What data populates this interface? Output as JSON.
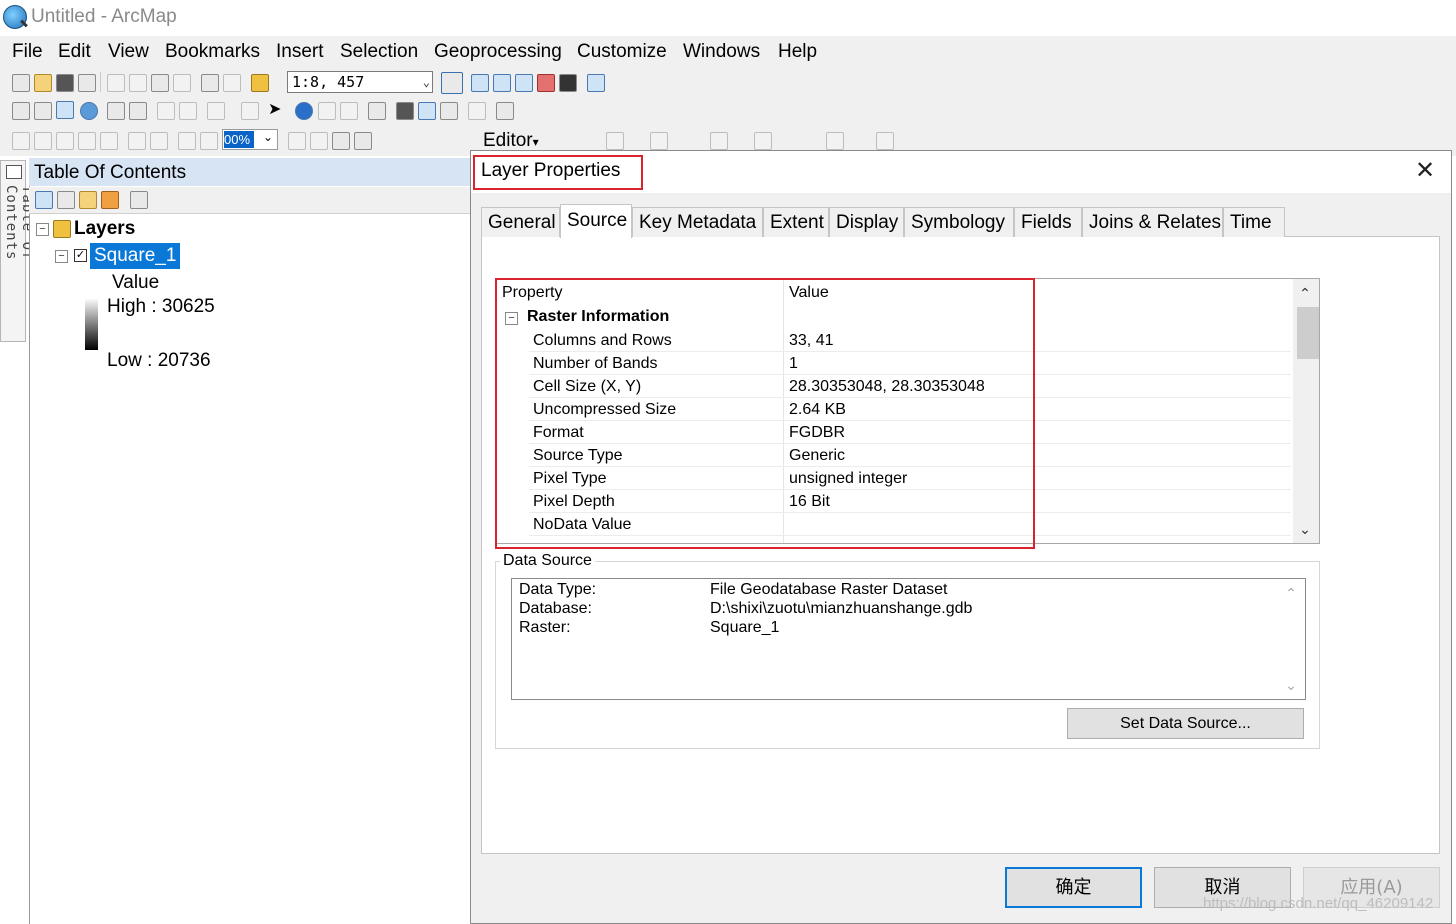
{
  "window": {
    "title": "Untitled - ArcMap"
  },
  "menu": [
    "File",
    "Edit",
    "View",
    "Bookmarks",
    "Insert",
    "Selection",
    "Geoprocessing",
    "Customize",
    "Windows",
    "Help"
  ],
  "toolbar": {
    "scale": "1:8, 457",
    "zoom_value": "00%",
    "editor_label": "Editor"
  },
  "toc": {
    "tab_label": "Table Of Contents",
    "title": "Table Of Contents",
    "root_label": "Layers",
    "layer": {
      "name": "Square_1",
      "checked": true,
      "legend_title": "Value",
      "high": "High : 30625",
      "low": "Low : 20736"
    }
  },
  "dialog": {
    "title": "Layer Properties",
    "tabs": [
      "General",
      "Source",
      "Key Metadata",
      "Extent",
      "Display",
      "Symbology",
      "Fields",
      "Joins & Relates",
      "Time"
    ],
    "active_tab": "Source",
    "property_table": {
      "header_property": "Property",
      "header_value": "Value",
      "group": "Raster Information",
      "rows": [
        {
          "key": "Columns and Rows",
          "value": "33, 41"
        },
        {
          "key": "Number of Bands",
          "value": "1"
        },
        {
          "key": "Cell Size (X, Y)",
          "value": "28.30353048, 28.30353048"
        },
        {
          "key": "Uncompressed Size",
          "value": "2.64 KB"
        },
        {
          "key": "Format",
          "value": "FGDBR"
        },
        {
          "key": "Source Type",
          "value": "Generic"
        },
        {
          "key": "Pixel Type",
          "value": "unsigned integer"
        },
        {
          "key": "Pixel Depth",
          "value": "16 Bit"
        },
        {
          "key": "NoData Value",
          "value": ""
        }
      ]
    },
    "data_source": {
      "label": "Data Source",
      "items": [
        {
          "label": "Data Type:",
          "value": "File Geodatabase Raster Dataset"
        },
        {
          "label": "Database:",
          "value": "D:\\shixi\\zuotu\\mianzhuanshange.gdb"
        },
        {
          "label": "Raster:",
          "value": "Square_1"
        }
      ],
      "set_button": "Set Data Source..."
    },
    "buttons": {
      "ok": "确定",
      "cancel": "取消",
      "apply": "应用(A)"
    }
  },
  "watermark": "https://blog.csdn.net/qq_46209142",
  "colors": {
    "highlight_red": "#d9232e",
    "selection_blue": "#0a78d7",
    "toc_header": "#d6e4f4"
  }
}
